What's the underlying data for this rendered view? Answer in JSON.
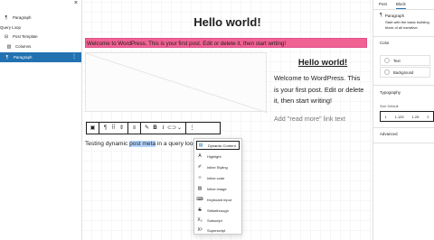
{
  "list_view": {
    "close_icon": "close-icon",
    "items": [
      {
        "label": "Paragraph",
        "icon": "paragraph-icon",
        "selected": false
      },
      {
        "label": "Query Loop",
        "icon": "loop-icon",
        "selected": false
      },
      {
        "label": "Post Template",
        "icon": "template-icon",
        "selected": false
      },
      {
        "label": "Columns",
        "icon": "columns-icon",
        "selected": false
      },
      {
        "label": "Paragraph",
        "icon": "paragraph-icon",
        "selected": true
      }
    ]
  },
  "canvas": {
    "post_title": "Hello world!",
    "welcome_text": "Welcome to WordPress. This is your first post. Edit or delete it, then start writing!",
    "query_right": {
      "title": "Hello world!",
      "excerpt": "Welcome to WordPress. This is your first post. Edit or delete it, then start writing!",
      "read_more": "Add \"read more\" link text"
    },
    "dynamic_paragraph": {
      "before": "Testing dynamic ",
      "highlight": "post meta",
      "after": " in a query loop"
    }
  },
  "toolbar": {
    "buttons": [
      "paragraph",
      "drag",
      "move",
      "align",
      "pen",
      "bold",
      "italic",
      "link",
      "more-rich-text",
      "options"
    ]
  },
  "format_menu": {
    "items": [
      {
        "label": "Dynamic Content",
        "icon": "database-icon",
        "active": true
      },
      {
        "label": "Highlight",
        "icon": "highlight-icon",
        "active": false
      },
      {
        "label": "Inline Styling",
        "icon": "brush-icon",
        "active": false
      },
      {
        "label": "Inline code",
        "icon": "code-icon",
        "active": false
      },
      {
        "label": "Inline image",
        "icon": "image-icon",
        "active": false
      },
      {
        "label": "Keyboard input",
        "icon": "keyboard-icon",
        "active": false
      },
      {
        "label": "Strikethrough",
        "icon": "strikethrough-icon",
        "active": false
      },
      {
        "label": "Subscript",
        "icon": "subscript-icon",
        "active": false
      },
      {
        "label": "Superscript",
        "icon": "superscript-icon",
        "active": false
      }
    ]
  },
  "sidebar": {
    "tabs": [
      "Post",
      "Block"
    ],
    "active_tab": "Block",
    "block_name": "Paragraph",
    "block_desc": "Start with the basic building block of all narrative.",
    "color_heading": "Color",
    "color_rows": [
      "Text",
      "Background"
    ],
    "typography_heading": "Typography",
    "size_label": "Size Default",
    "size_options": [
      "1",
      "1.125",
      "1.25",
      "2"
    ],
    "advanced_heading": "Advanced"
  },
  "colors": {
    "accent": "#2271b1",
    "pink_bg": "#f06292",
    "selection": "#b4d5fe"
  }
}
